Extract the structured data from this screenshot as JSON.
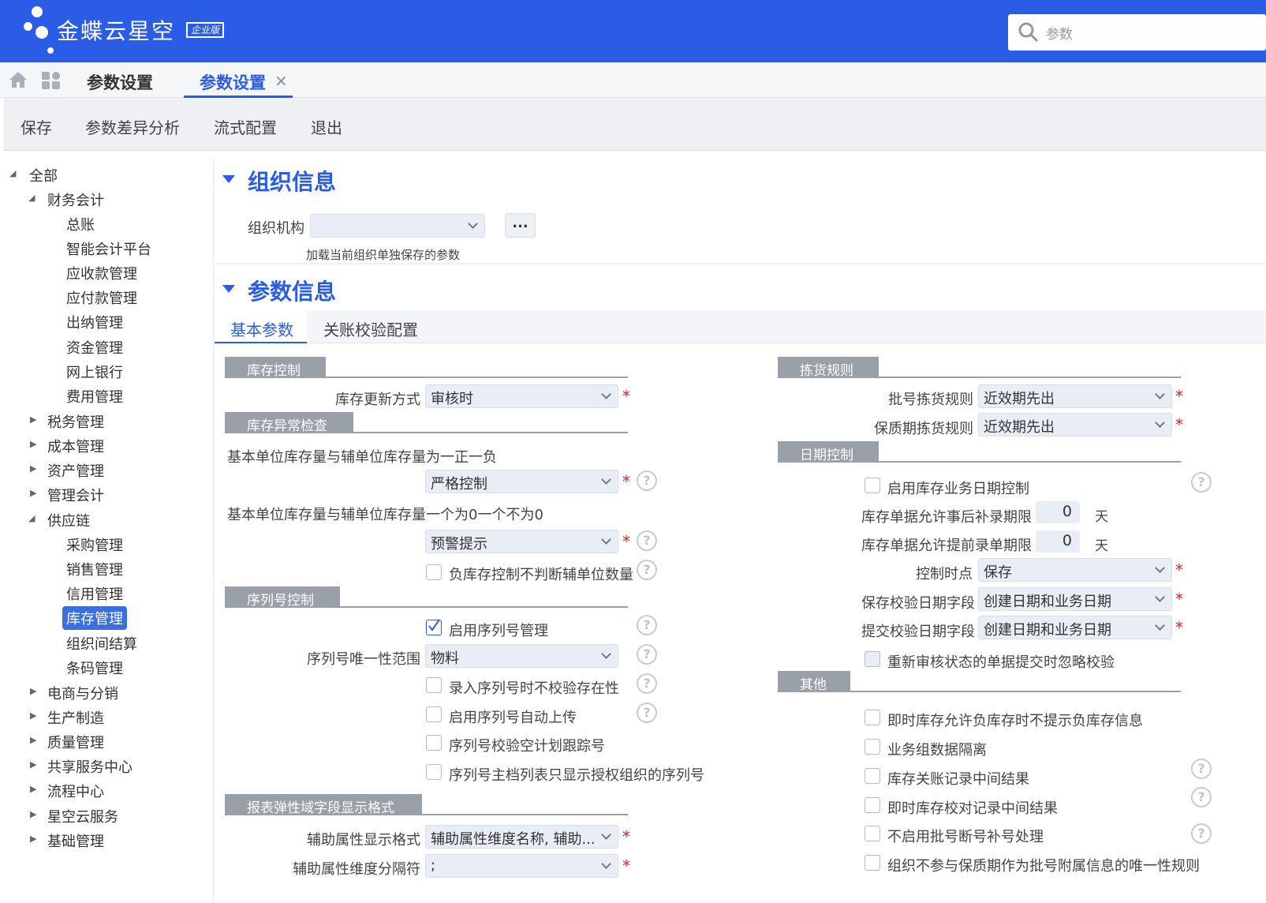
{
  "app": {
    "brand": "金蝶云星空",
    "edition": "企业版",
    "search_placeholder": "参数"
  },
  "tabs": {
    "breadcrumb": "参数设置",
    "active": "参数设置",
    "close": "×"
  },
  "toolbar": {
    "save": "保存",
    "diff": "参数差异分析",
    "flow": "流式配置",
    "exit": "退出"
  },
  "tree": [
    "全部",
    "财务会计",
    "总账",
    "智能会计平台",
    "应收款管理",
    "应付款管理",
    "出纳管理",
    "资金管理",
    "网上银行",
    "费用管理",
    "税务管理",
    "成本管理",
    "资产管理",
    "管理会计",
    "供应链",
    "采购管理",
    "销售管理",
    "信用管理",
    "库存管理",
    "组织间结算",
    "条码管理",
    "电商与分销",
    "生产制造",
    "质量管理",
    "共享服务中心",
    "流程中心",
    "星空云服务",
    "基础管理"
  ],
  "org": {
    "title": "组织信息",
    "label": "组织机构",
    "more": "...",
    "hint": "加载当前组织单独保存的参数"
  },
  "params": {
    "title": "参数信息",
    "tab1": "基本参数",
    "tab2": "关账校验配置"
  },
  "left": {
    "g1": "库存控制",
    "update_label": "库存更新方式",
    "update_value": "审核时",
    "g2": "库存异常检查",
    "q1": "基本单位库存量与辅单位库存量为一正一负",
    "q1_value": "严格控制",
    "q2": "基本单位库存量与辅单位库存量一个为0一个不为0",
    "q2_value": "预警提示",
    "neg": "负库存控制不判断辅单位数量",
    "g3": "序列号控制",
    "sn_enable": "启用序列号管理",
    "sn_scope_label": "序列号唯一性范围",
    "sn_scope": "物料",
    "sn1": "录入序列号时不校验存在性",
    "sn2": "启用序列号自动上传",
    "sn3": "序列号校验空计划跟踪号",
    "sn4": "序列号主档列表只显示授权组织的序列号",
    "g4": "报表弹性域字段显示格式",
    "aux_label": "辅助属性显示格式",
    "aux_value": "辅助属性维度名称, 辅助...",
    "sep_label": "辅助属性维度分隔符",
    "sep_value": ";"
  },
  "right": {
    "g1": "拣货规则",
    "batch_label": "批号拣货规则",
    "batch_value": "近效期先出",
    "shelf_label": "保质期拣货规则",
    "shelf_value": "近效期先出",
    "g2": "日期控制",
    "date_enable": "启用库存业务日期控制",
    "after_label": "库存单据允许事后补录期限",
    "after_value": "0",
    "before_label": "库存单据允许提前录单期限",
    "before_value": "0",
    "day": "天",
    "point_label": "控制时点",
    "point_value": "保存",
    "save_field_label": "保存校验日期字段",
    "save_field_value": "创建日期和业务日期",
    "submit_field_label": "提交校验日期字段",
    "submit_field_value": "创建日期和业务日期",
    "reaudit": "重新审核状态的单据提交时忽略校验",
    "g3": "其他",
    "o1": "即时库存允许负库存时不提示负库存信息",
    "o2": "业务组数据隔离",
    "o3": "库存关账记录中间结果",
    "o4": "即时库存校对记录中间结果",
    "o5": "不启用批号断号补号处理",
    "o6": "组织不参与保质期作为批号附属信息的唯一性规则"
  },
  "help_glyph": "?",
  "required_mark": "*",
  "colors": {
    "brand": "#2b5ce6",
    "selected": "#3a6fe0",
    "group": "#9aa0a8"
  }
}
